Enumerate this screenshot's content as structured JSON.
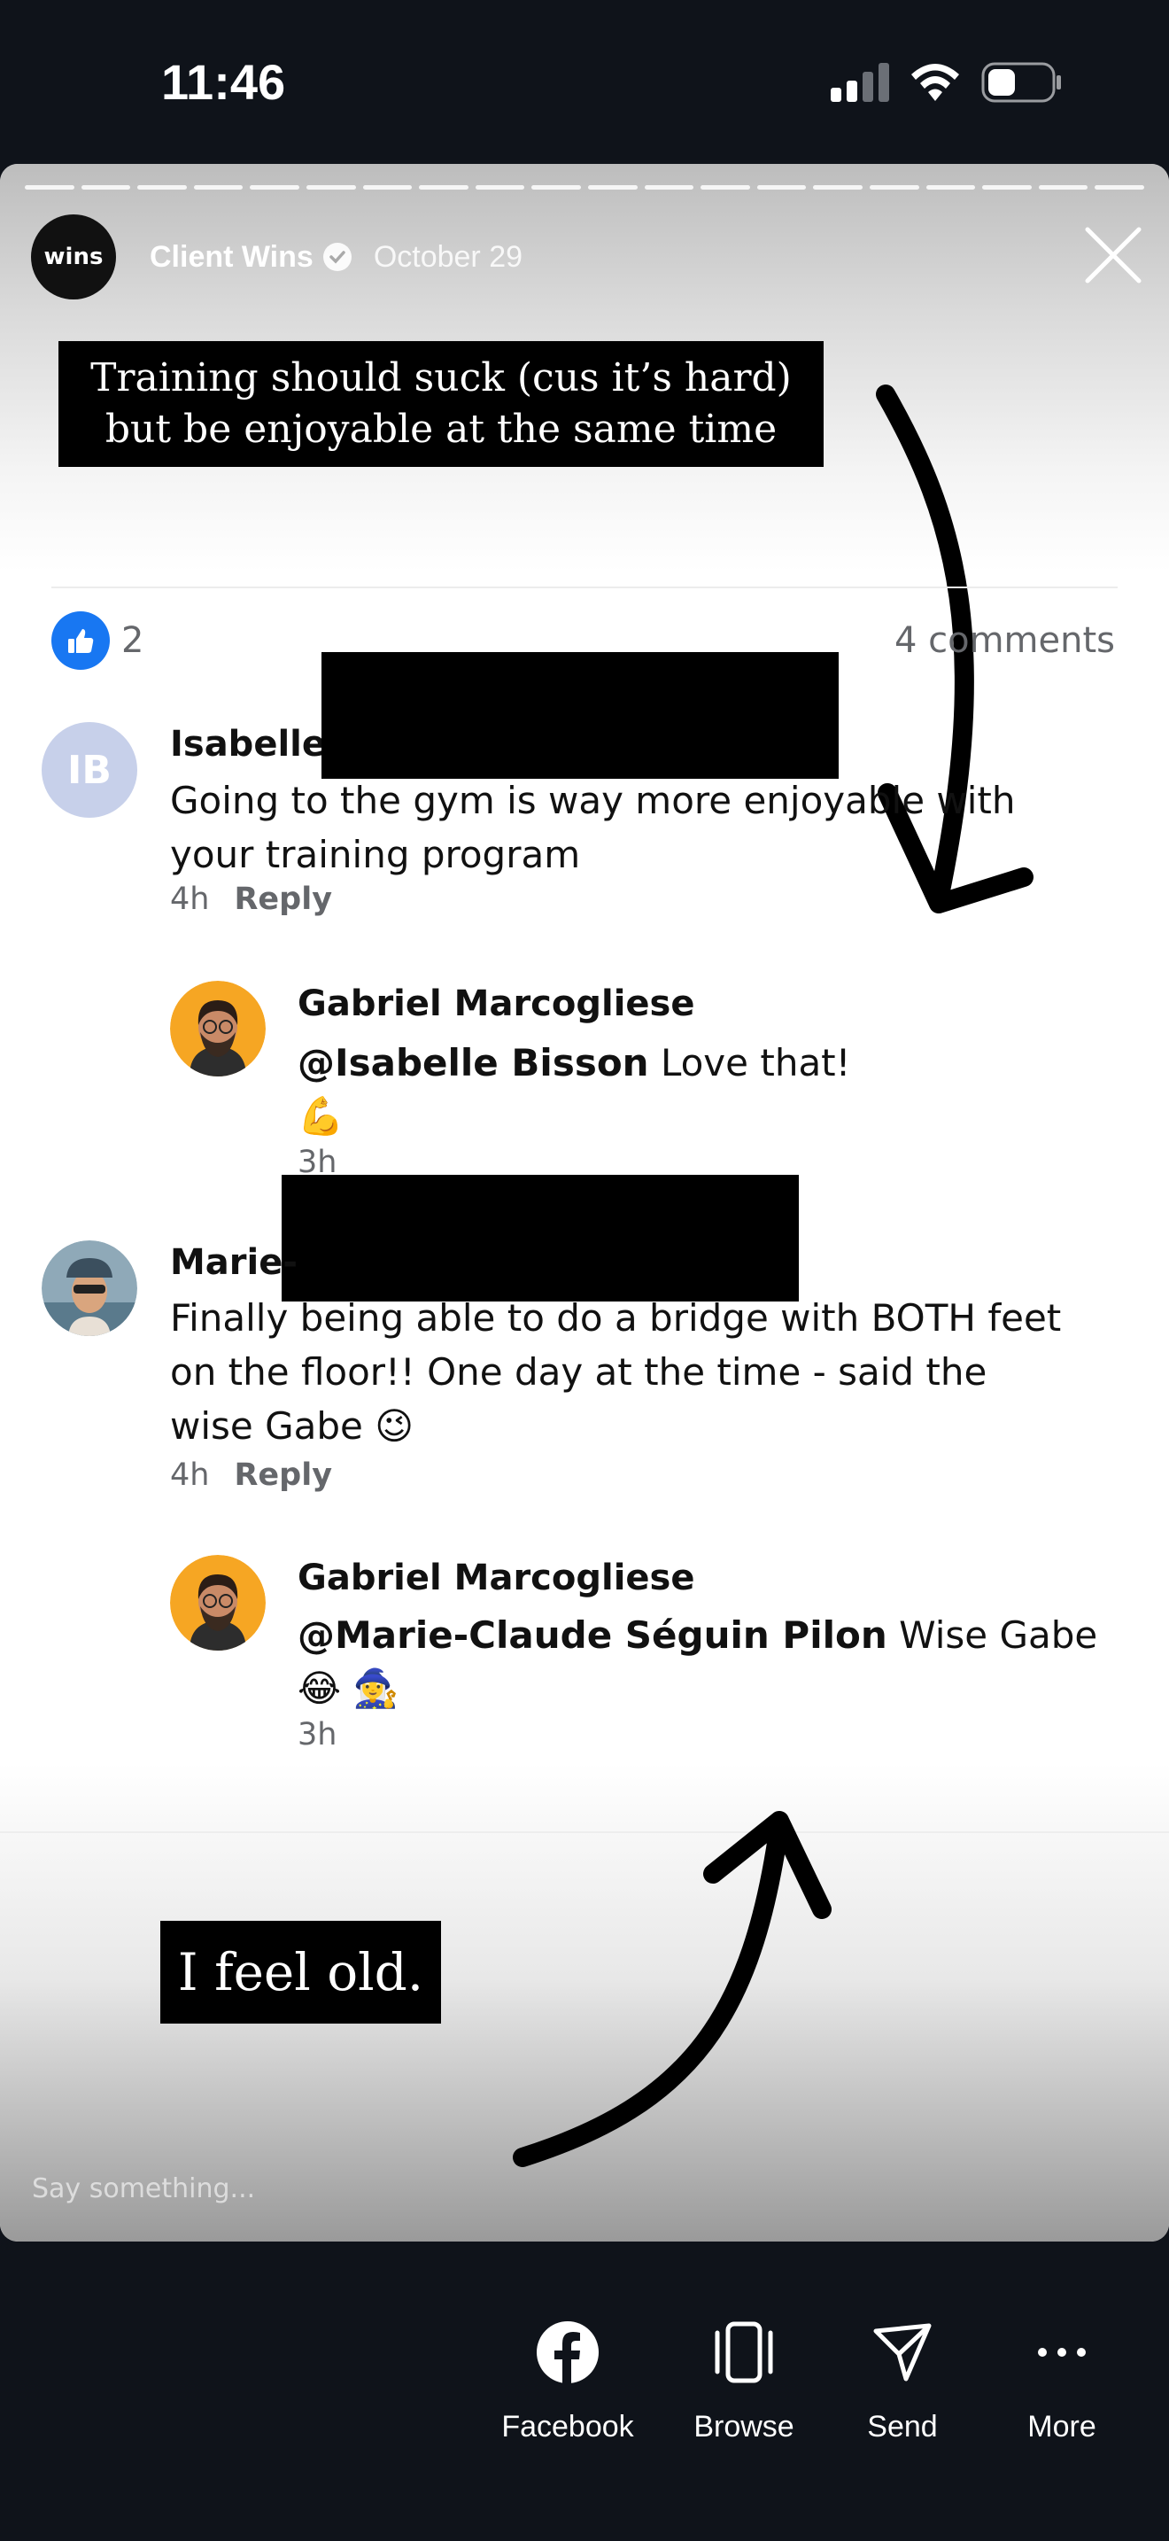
{
  "status_bar": {
    "time": "11:46"
  },
  "story": {
    "account_logo_text": "wins",
    "account_name": "Client Wins",
    "date": "October 29",
    "caption_top": "Training should suck (cus it’s hard) but be enjoyable at the same time",
    "caption_bottom": "I feel old.",
    "input_placeholder": "Say something..."
  },
  "post": {
    "likes": "2",
    "comments_count": "4 comments",
    "comments": [
      {
        "initials": "IB",
        "name": "Isabelle",
        "text": "Going to the gym is way more enjoyable with your training program",
        "time": "4h",
        "reply_label": "Reply"
      },
      {
        "name": "Gabriel Marcogliese",
        "mention": "@Isabelle Bisson",
        "text": "Love that!",
        "emoji": "💪",
        "time": "3h"
      },
      {
        "name": "Marie-",
        "text": "Finally being able to do a bridge with BOTH feet on the floor!! One day at the time - said the wise Gabe 😉",
        "time": "4h",
        "reply_label": "Reply"
      },
      {
        "name": "Gabriel Marcogliese",
        "mention": "@Marie-Claude Séguin Pilon",
        "text": "Wise Gabe",
        "emoji": "😂 🧙‍♀️",
        "time": "3h"
      }
    ]
  },
  "actions": {
    "facebook": "Facebook",
    "browse": "Browse",
    "send": "Send",
    "more": "More"
  },
  "colors": {
    "like_blue": "#1877f2",
    "background": "#0f131a"
  }
}
